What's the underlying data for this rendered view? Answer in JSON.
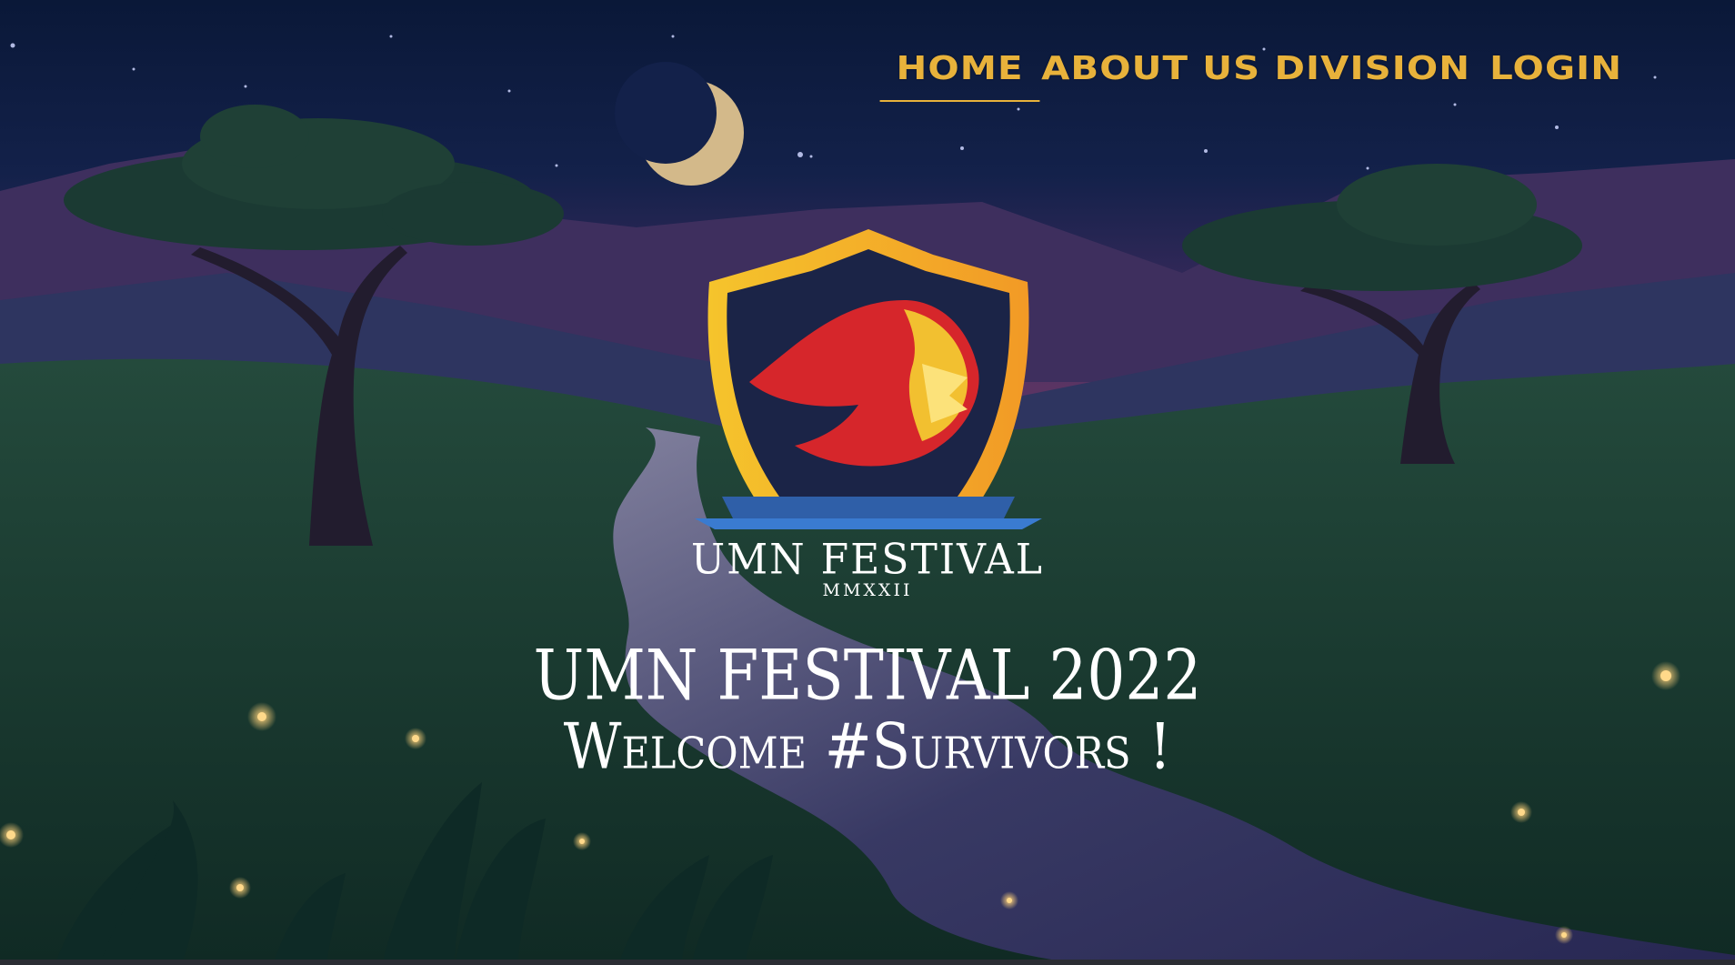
{
  "nav": {
    "items": [
      {
        "label": "HOME",
        "active": true
      },
      {
        "label": "ABOUT US",
        "active": false
      },
      {
        "label": "DIVISION",
        "active": false
      },
      {
        "label": "LOGIN",
        "active": false
      }
    ]
  },
  "logo": {
    "title": "UMN FESTIVAL",
    "subtitle": "MMXXII"
  },
  "hero": {
    "line1": "UMN FESTIVAL 2022",
    "line2": "Welcome #Survivors !"
  },
  "colors": {
    "accent": "#e8b23b",
    "sky": "#0b1530",
    "lion_red": "#d6262b",
    "shield_gold": "#f2b731"
  },
  "icons": [
    "crescent-moon-icon",
    "lion-crest-icon"
  ]
}
